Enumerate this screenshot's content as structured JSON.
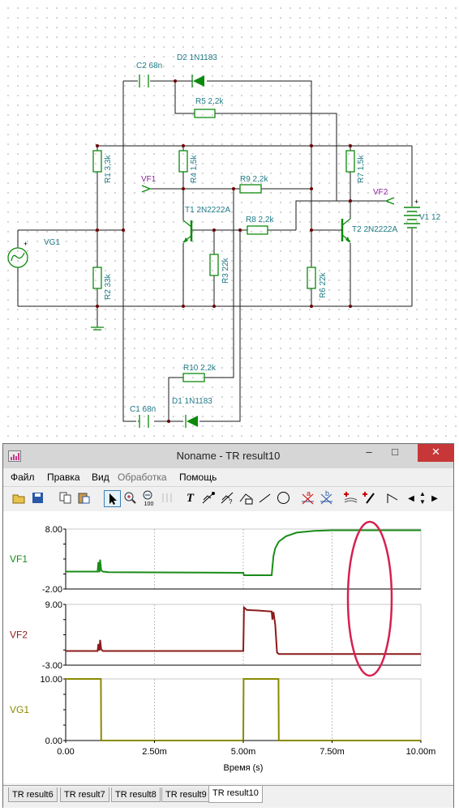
{
  "schematic": {
    "labels": {
      "c2": "C2 68n",
      "d2": "D2 1N1183",
      "r5": "R5 2,2k",
      "r1": "R1 3,3k",
      "r4": "R4 1,5k",
      "r7": "R7 1,5k",
      "vf1": "VF1",
      "r9": "R9 2,2k",
      "vf2": "VF2",
      "v1": "V1 12",
      "vg1": "VG1",
      "t1": "T1 2N2222A",
      "r8": "R8 2,2k",
      "t2": "T2 2N2222A",
      "r3": "R3 22k",
      "r2": "R2 33k",
      "r6": "R6 22k",
      "r10": "R10 2,2k",
      "d1": "D1 1N1183",
      "c1": "C1 68n"
    }
  },
  "window": {
    "title": "Noname - TR result10",
    "minimize": "–",
    "maximize": "□",
    "close": "✕"
  },
  "menu": [
    "Файл",
    "Правка",
    "Вид",
    "Обработка",
    "Помощь"
  ],
  "toolbar_icons": [
    "open-icon",
    "save-icon",
    "copy-icon",
    "paste-icon",
    "pointer-icon",
    "zoom-in-icon",
    "zoom-100-icon",
    "grid-icon",
    "text-icon",
    "cursor-a-icon",
    "cursor-b-icon",
    "cursor-c-icon",
    "line-icon",
    "circle-icon",
    "marker-a-icon",
    "marker-b-icon",
    "curves-icon",
    "probe-icon",
    "pen-icon",
    "slope-icon"
  ],
  "toolbar_glyphs": {
    "text": "T",
    "zoom100": "100",
    "a": "a",
    "b": "b"
  },
  "chart_data": [
    {
      "type": "line",
      "series": [
        {
          "name": "VF1"
        }
      ],
      "ylim": [
        -2.0,
        8.0
      ],
      "yticks": [
        "8.00",
        "-2.00"
      ],
      "color": "#1a8c1a",
      "x_ms": [
        0,
        0.9,
        0.92,
        0.95,
        0.97,
        1.0,
        1.05,
        1.2,
        5.0,
        5.02,
        5.8,
        5.85,
        5.9,
        6.0,
        6.2,
        6.5,
        7.0,
        7.5,
        8.0,
        10.0
      ],
      "y": [
        0.9,
        0.9,
        2.5,
        0.8,
        2.9,
        1.1,
        0.9,
        0.8,
        0.7,
        0.3,
        0.3,
        3.5,
        4.8,
        5.9,
        6.8,
        7.4,
        7.7,
        7.8,
        7.8,
        7.8
      ]
    },
    {
      "type": "line",
      "series": [
        {
          "name": "VF2"
        }
      ],
      "ylim": [
        -3.0,
        9.0
      ],
      "yticks": [
        "9.00",
        "-3.00"
      ],
      "color": "#8b1a1a",
      "x_ms": [
        0,
        0.9,
        0.92,
        0.95,
        0.97,
        1.0,
        1.05,
        5.0,
        5.02,
        5.1,
        5.4,
        5.8,
        5.82,
        5.85,
        5.9,
        5.95,
        6.0,
        10.0
      ],
      "y": [
        -0.2,
        -0.2,
        1.2,
        -0.1,
        2.0,
        0.1,
        -0.2,
        -0.2,
        8.4,
        7.9,
        7.8,
        7.6,
        6.0,
        7.5,
        5.0,
        -0.5,
        -0.8,
        -0.8
      ]
    },
    {
      "type": "line",
      "series": [
        {
          "name": "VG1"
        }
      ],
      "ylim": [
        0.0,
        10.0
      ],
      "yticks": [
        "10.00",
        "0.00"
      ],
      "color": "#8a8a00",
      "x_ms": [
        0,
        0.99,
        1.0,
        5.0,
        5.01,
        5.99,
        6.0,
        10.0
      ],
      "y": [
        10,
        10,
        0,
        0,
        10,
        10,
        0,
        0
      ]
    }
  ],
  "x_axis": {
    "label": "Время (s)",
    "xlim": [
      0,
      10
    ],
    "ticks": [
      0,
      2.5,
      5.0,
      7.5,
      10.0
    ],
    "tick_labels": [
      "0.00",
      "2.50m",
      "5.00m",
      "7.50m",
      "10.00m"
    ]
  },
  "tabs": [
    "TR result6",
    "TR result7",
    "TR result8",
    "TR result9",
    "TR result10"
  ],
  "active_tab": "TR result10",
  "highlight_color": "#d62050"
}
